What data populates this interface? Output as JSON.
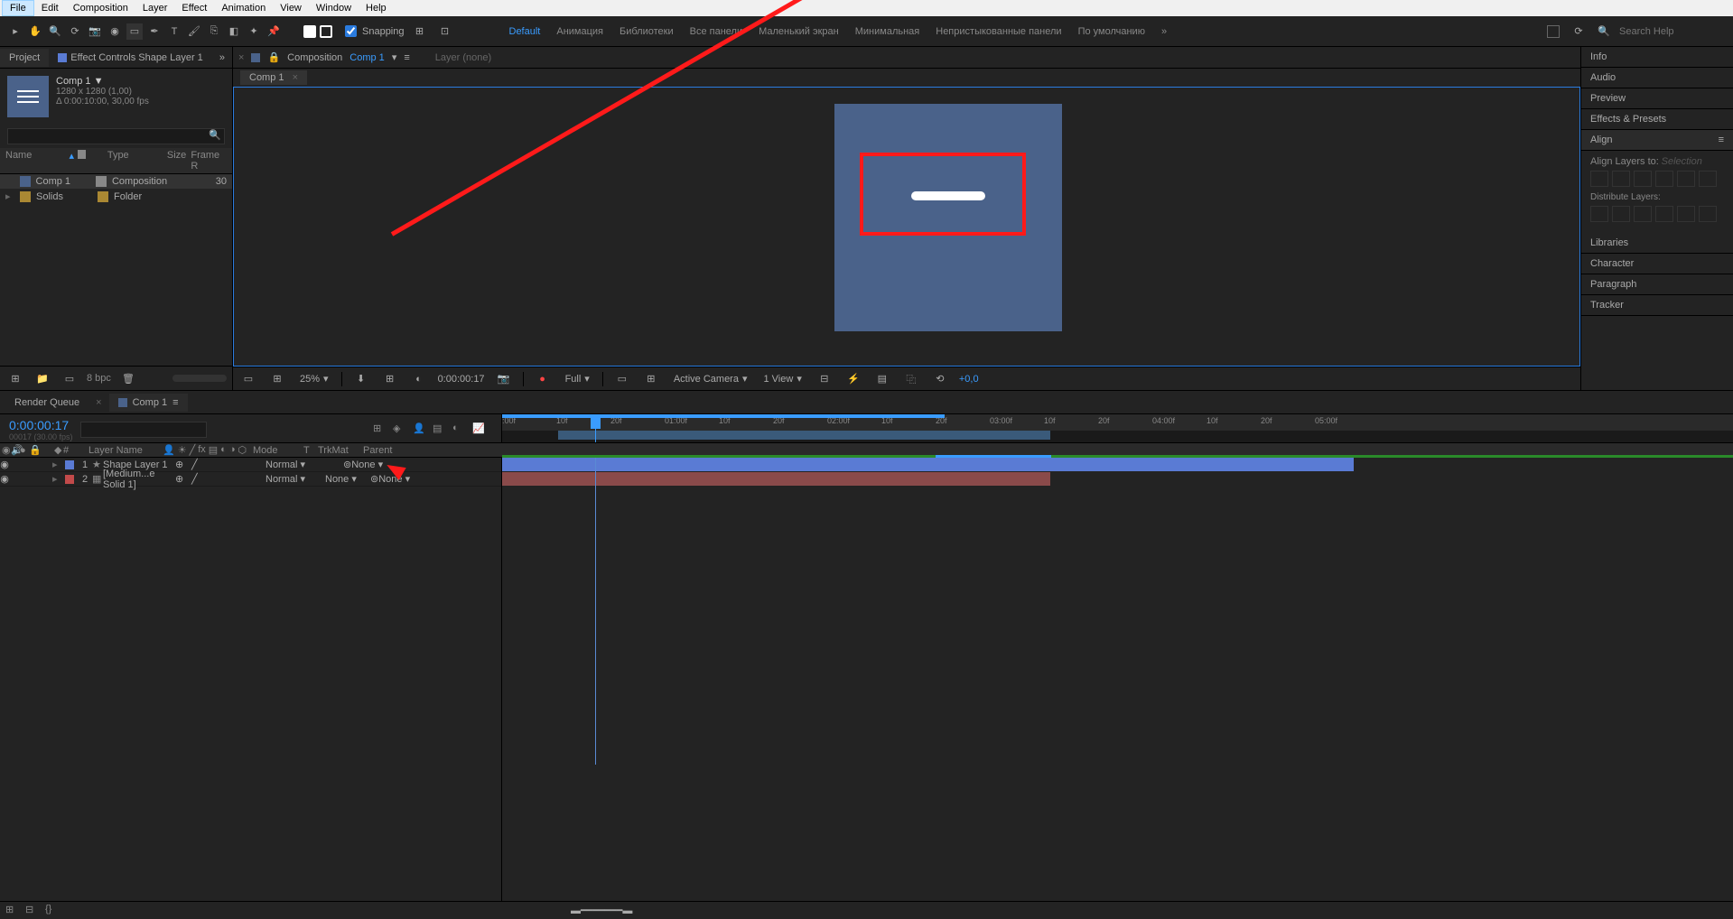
{
  "menubar": [
    "File",
    "Edit",
    "Composition",
    "Layer",
    "Effect",
    "Animation",
    "View",
    "Window",
    "Help"
  ],
  "toolbar": {
    "snapping_label": "Snapping",
    "search_placeholder": "Search Help"
  },
  "workspaces": [
    "Default",
    "Анимация",
    "Библиотеки",
    "Все панели",
    "Маленький экран",
    "Минимальная",
    "Непристыкованные панели",
    "По умолчанию"
  ],
  "project_panel": {
    "tabs": [
      "Project",
      "Effect Controls Shape Layer 1"
    ],
    "comp_name": "Comp 1",
    "comp_dims": "1280 x 1280 (1,00)",
    "comp_dur": "Δ 0:00:10:00, 30,00 fps",
    "columns": [
      "Name",
      "Type",
      "Size",
      "Frame R"
    ],
    "items": [
      {
        "name": "Comp 1",
        "type": "Composition",
        "fr": "30",
        "icon": "comp",
        "sel": true
      },
      {
        "name": "Solids",
        "type": "Folder",
        "fr": "",
        "icon": "folder",
        "sel": false
      }
    ],
    "bpc": "8 bpc"
  },
  "comp_panel": {
    "header_label": "Composition",
    "header_comp": "Comp 1",
    "layer_label": "Layer (none)",
    "tab": "Comp 1",
    "viewer_bar": {
      "zoom": "25%",
      "timecode": "0:00:00:17",
      "res": "Full",
      "camera": "Active Camera",
      "view": "1 View",
      "exposure": "+0,0"
    }
  },
  "right_panel": {
    "items": [
      "Info",
      "Audio",
      "Preview",
      "Effects & Presets",
      "Align"
    ],
    "align": {
      "label1": "Align Layers to:",
      "selection": "Selection",
      "label2": "Distribute Layers:"
    },
    "items2": [
      "Libraries",
      "Character",
      "Paragraph",
      "Tracker"
    ]
  },
  "timeline": {
    "tabs": [
      "Render Queue",
      "Comp 1"
    ],
    "timecode": "0:00:00:17",
    "timecode_sub": "00017 (30.00 fps)",
    "layer_cols": {
      "layer_name": "Layer Name",
      "mode": "Mode",
      "trkmat": "TrkMat",
      "parent": "Parent",
      "idx": "#",
      "t": "T"
    },
    "layers": [
      {
        "idx": "1",
        "name": "Shape Layer 1",
        "mode": "Normal",
        "parent": "None",
        "color": "#5a7bd4"
      },
      {
        "idx": "2",
        "name": "[Medium...e Solid 1]",
        "mode": "Normal",
        "parent": "None",
        "color": "#c24a4a"
      }
    ],
    "ruler_marks": [
      ":00f",
      "10f",
      "20f",
      "01:00f",
      "10f",
      "20f",
      "02:00f",
      "10f",
      "20f",
      "03:00f",
      "10f",
      "20f",
      "04:00f",
      "10f",
      "20f",
      "05:00f"
    ]
  }
}
